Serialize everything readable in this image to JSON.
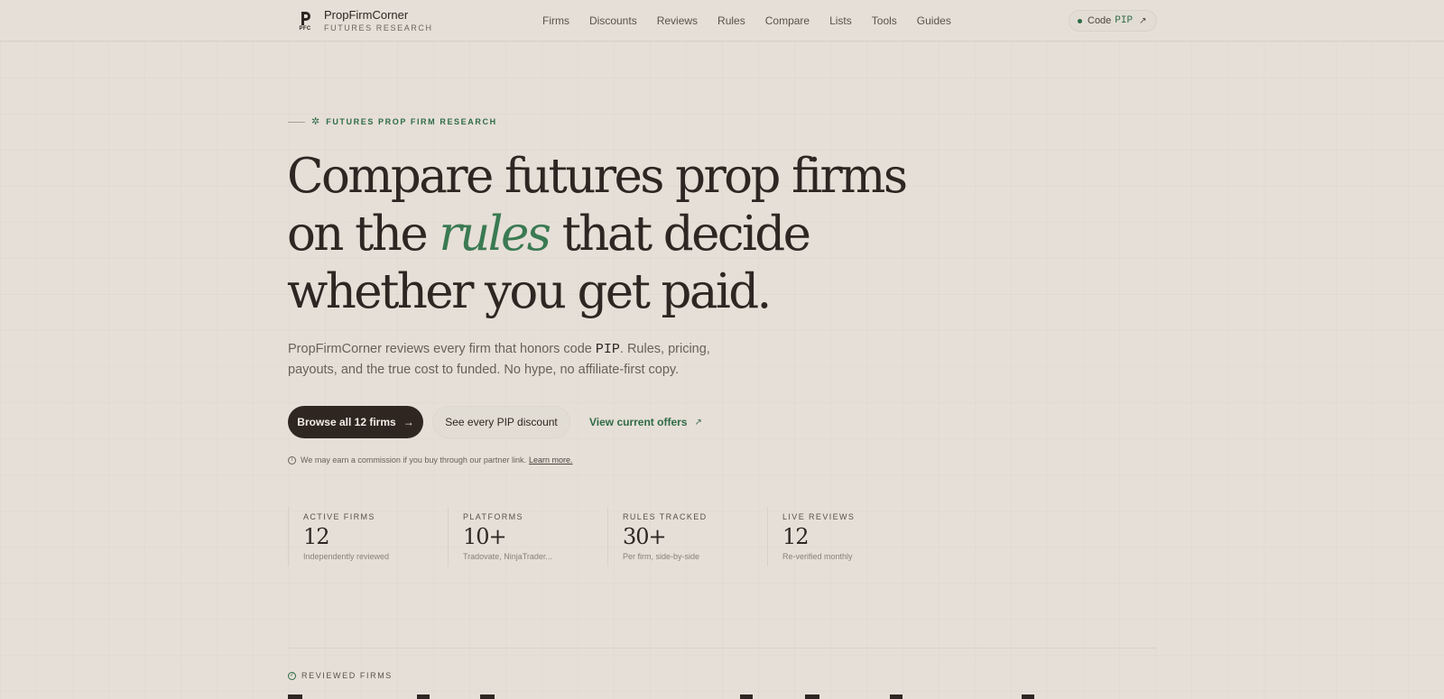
{
  "header": {
    "brand_name": "PropFirmCorner",
    "brand_sub": "FUTURES RESEARCH",
    "logo_abbr": "PFC",
    "nav": [
      "Firms",
      "Discounts",
      "Reviews",
      "Rules",
      "Compare",
      "Lists",
      "Tools",
      "Guides"
    ],
    "code_pill": {
      "label": "Code",
      "code": "PIP",
      "icon": "arrow-up-right-icon"
    }
  },
  "hero": {
    "eyebrow": "FUTURES PROP FIRM RESEARCH",
    "headline_part1": "Compare futures prop firms on the ",
    "headline_accent": "rules",
    "headline_part2": " that decide whether you get paid.",
    "lede_part1": "PropFirmCorner reviews every firm that honors code ",
    "lede_code": "PIP",
    "lede_part2": ". Rules, pricing, payouts, and the true cost to funded. No hype, no affiliate-first copy.",
    "primary_button": "Browse all 12 firms",
    "secondary_button": "See every PIP discount",
    "link_button": "View current offers",
    "disclosure": "We may earn a commission if you buy through our partner link.",
    "disclosure_link": "Learn more."
  },
  "stats": [
    {
      "label": "ACTIVE FIRMS",
      "value": "12",
      "sub": "Independently reviewed"
    },
    {
      "label": "PLATFORMS",
      "value": "10+",
      "sub": "Tradovate, NinjaTrader..."
    },
    {
      "label": "RULES TRACKED",
      "value": "30+",
      "sub": "Per firm, side-by-side"
    },
    {
      "label": "LIVE REVIEWS",
      "value": "12",
      "sub": "Re-verified monthly"
    }
  ],
  "section": {
    "label": "REVIEWED FIRMS"
  },
  "colors": {
    "accent": "#2f6b46",
    "ink": "#2e2622",
    "background": "#e6dfd7"
  }
}
